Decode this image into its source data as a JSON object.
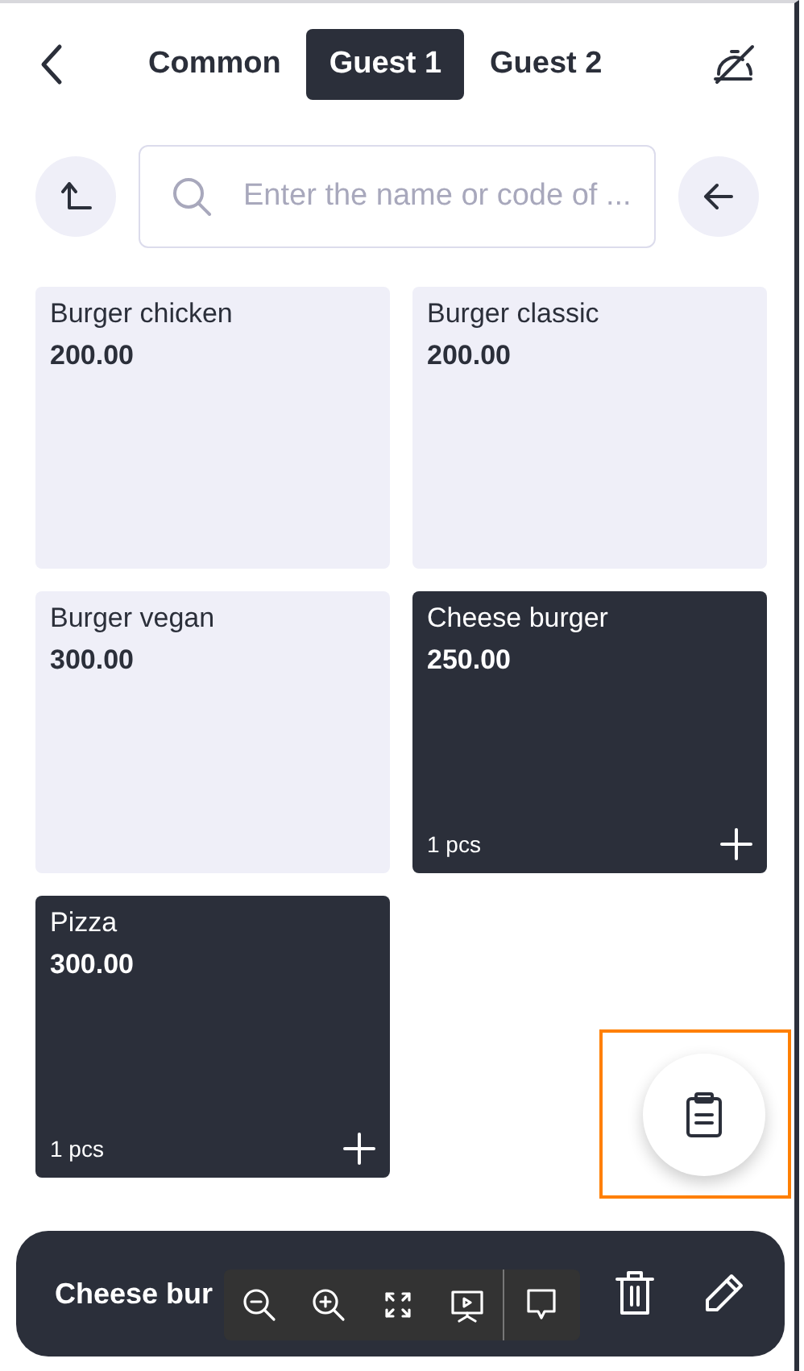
{
  "tabs": [
    {
      "label": "Common",
      "selected": false
    },
    {
      "label": "Guest 1",
      "selected": true
    },
    {
      "label": "Guest 2",
      "selected": false
    }
  ],
  "search": {
    "placeholder": "Enter the name or code of ..."
  },
  "products": [
    {
      "name": "Burger chicken",
      "price": "200.00",
      "selected": false
    },
    {
      "name": "Burger classic",
      "price": "200.00",
      "selected": false
    },
    {
      "name": "Burger vegan",
      "price": "300.00",
      "selected": false
    },
    {
      "name": "Cheese burger",
      "price": "250.00",
      "selected": true,
      "quantity": "1 pcs"
    },
    {
      "name": "Pizza",
      "price": "300.00",
      "selected": true,
      "quantity": "1 pcs"
    }
  ],
  "bottom_bar": {
    "title": "Cheese bur"
  }
}
